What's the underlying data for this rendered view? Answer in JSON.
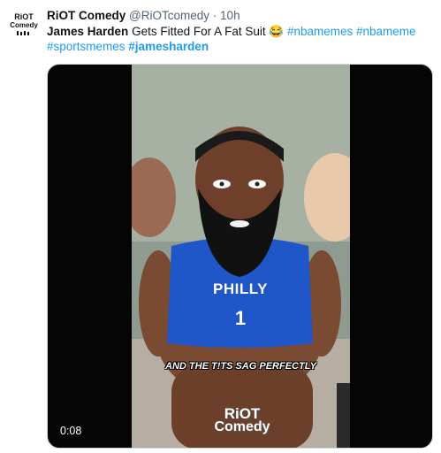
{
  "tweet": {
    "author_name": "RiOT Comedy",
    "handle": "@RiOTcomedy",
    "separator": "·",
    "time": "10h",
    "text_bold": "James Harden",
    "text_rest": " Gets Fitted For A Fat Suit 😂 ",
    "hashtags": [
      "#nbamemes",
      "#nbameme",
      "#sportsmemes",
      "#jamesharden"
    ]
  },
  "avatar": {
    "logo_line1": "RiOT",
    "logo_line2": "Comedy"
  },
  "media": {
    "duration": "0:08",
    "caption": "AND THE T!TS SAG PERFECTLY",
    "shirt_line1": "PHILLY",
    "shirt_line2": "1",
    "watermark_line1": "RiOT",
    "watermark_line2": "Comedy"
  },
  "colors": {
    "link": "#1d9bf0",
    "muted": "#536471",
    "jersey": "#1f56c8"
  }
}
